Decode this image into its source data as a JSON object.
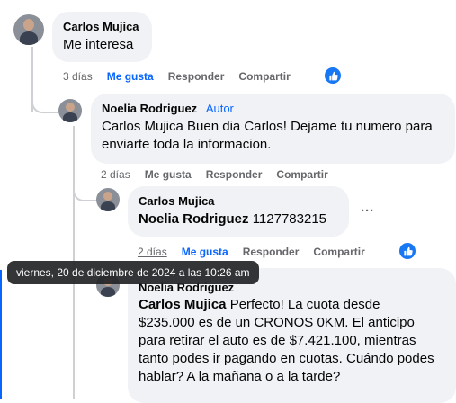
{
  "comments": [
    {
      "author": "Carlos Mujica",
      "text": "Me interesa",
      "time": "3 días",
      "like_label": "Me gusta",
      "reply_label": "Responder",
      "share_label": "Compartir"
    },
    {
      "author": "Noelia Rodriguez",
      "badge": "Autor",
      "text": "Carlos Mujica Buen dia Carlos! Dejame tu numero para enviarte toda la informacion.",
      "time": "2 días",
      "like_label": "Me gusta",
      "reply_label": "Responder",
      "share_label": "Compartir"
    },
    {
      "author": "Carlos Mujica",
      "mention": "Noelia Rodriguez",
      "text": "1127783215",
      "time": "2 días",
      "like_label": "Me gusta",
      "reply_label": "Responder",
      "share_label": "Compartir",
      "more": "···"
    },
    {
      "author": "Noelia Rodriguez",
      "mention": "Carlos Mujica",
      "text": "Perfecto! La cuota desde $235.000 es de un CRONOS 0KM. El anticipo para retirar el auto es de $7.421.100, mientras tanto podes ir pagando en cuotas. Cuándo podes hablar? A la mañana o a la tarde?"
    }
  ],
  "tooltip": "viernes, 20 de diciembre de 2024 a las 10:26 am",
  "colors": {
    "link_blue": "#0866ff",
    "bubble_bg": "#f0f2f5",
    "meta_gray": "#65676b",
    "like_blue": "#1877f2"
  }
}
